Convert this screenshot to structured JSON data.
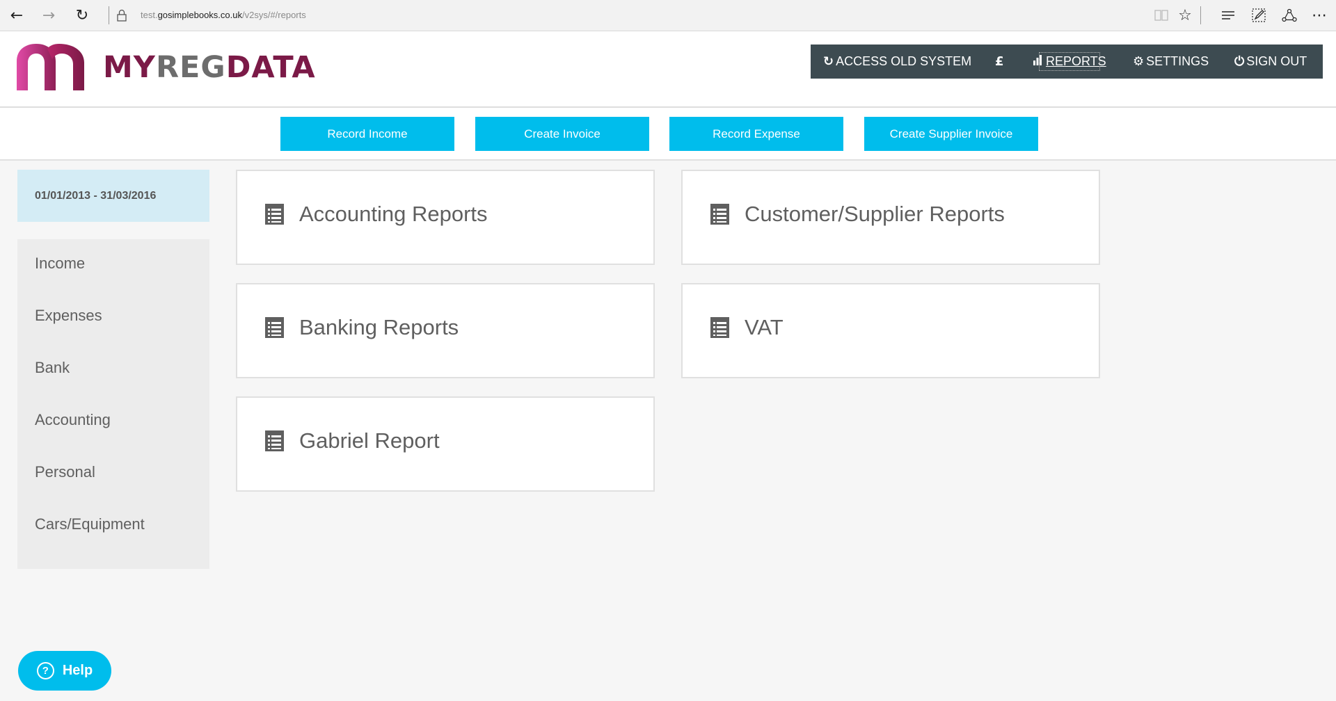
{
  "browser": {
    "url_prefix": "test.",
    "url_host": "gosimplebooks.co.uk",
    "url_path": "/v2sys/#/reports",
    "icons": {
      "back": "←",
      "forward": "→",
      "refresh": "↻",
      "lock": "🔒",
      "reading_view": "📖",
      "favorite": "☆",
      "hub": "≡",
      "web_note": "✎",
      "share": "⟡",
      "more": "⋯"
    }
  },
  "brand": {
    "logo_part1": "MY",
    "logo_part2": "REG",
    "logo_part3": "DATA",
    "colors": {
      "primary": "#7b1a47",
      "secondary": "#6d6d6d",
      "accent": "#00bdec",
      "nav_bg": "#3d4b51"
    }
  },
  "topnav": {
    "items": [
      {
        "label": "ACCESS OLD SYSTEM",
        "icon": "↻",
        "active": false
      },
      {
        "label": "",
        "icon": "£",
        "active": false
      },
      {
        "label": "REPORTS",
        "icon": "▮",
        "active": true
      },
      {
        "label": "SETTINGS",
        "icon": "⚙",
        "active": false
      },
      {
        "label": "SIGN OUT",
        "icon": "⏻",
        "active": false
      }
    ]
  },
  "actions": [
    {
      "label": "Record Income"
    },
    {
      "label": "Create Invoice"
    },
    {
      "label": "Record Expense"
    },
    {
      "label": "Create Supplier Invoice"
    }
  ],
  "sidebar": {
    "date_range": "01/01/2013 - 31/03/2016",
    "items": [
      {
        "label": "Income"
      },
      {
        "label": "Expenses"
      },
      {
        "label": "Bank"
      },
      {
        "label": "Accounting"
      },
      {
        "label": "Personal"
      },
      {
        "label": "Cars/Equipment"
      }
    ]
  },
  "reports": [
    {
      "title": "Accounting Reports",
      "icon": "list-icon"
    },
    {
      "title": "Customer/Supplier Reports",
      "icon": "list-icon"
    },
    {
      "title": "Banking Reports",
      "icon": "list-icon"
    },
    {
      "title": "VAT",
      "icon": "list-icon"
    },
    {
      "title": "Gabriel Report",
      "icon": "list-icon"
    }
  ],
  "help": {
    "label": "Help",
    "icon": "?"
  }
}
